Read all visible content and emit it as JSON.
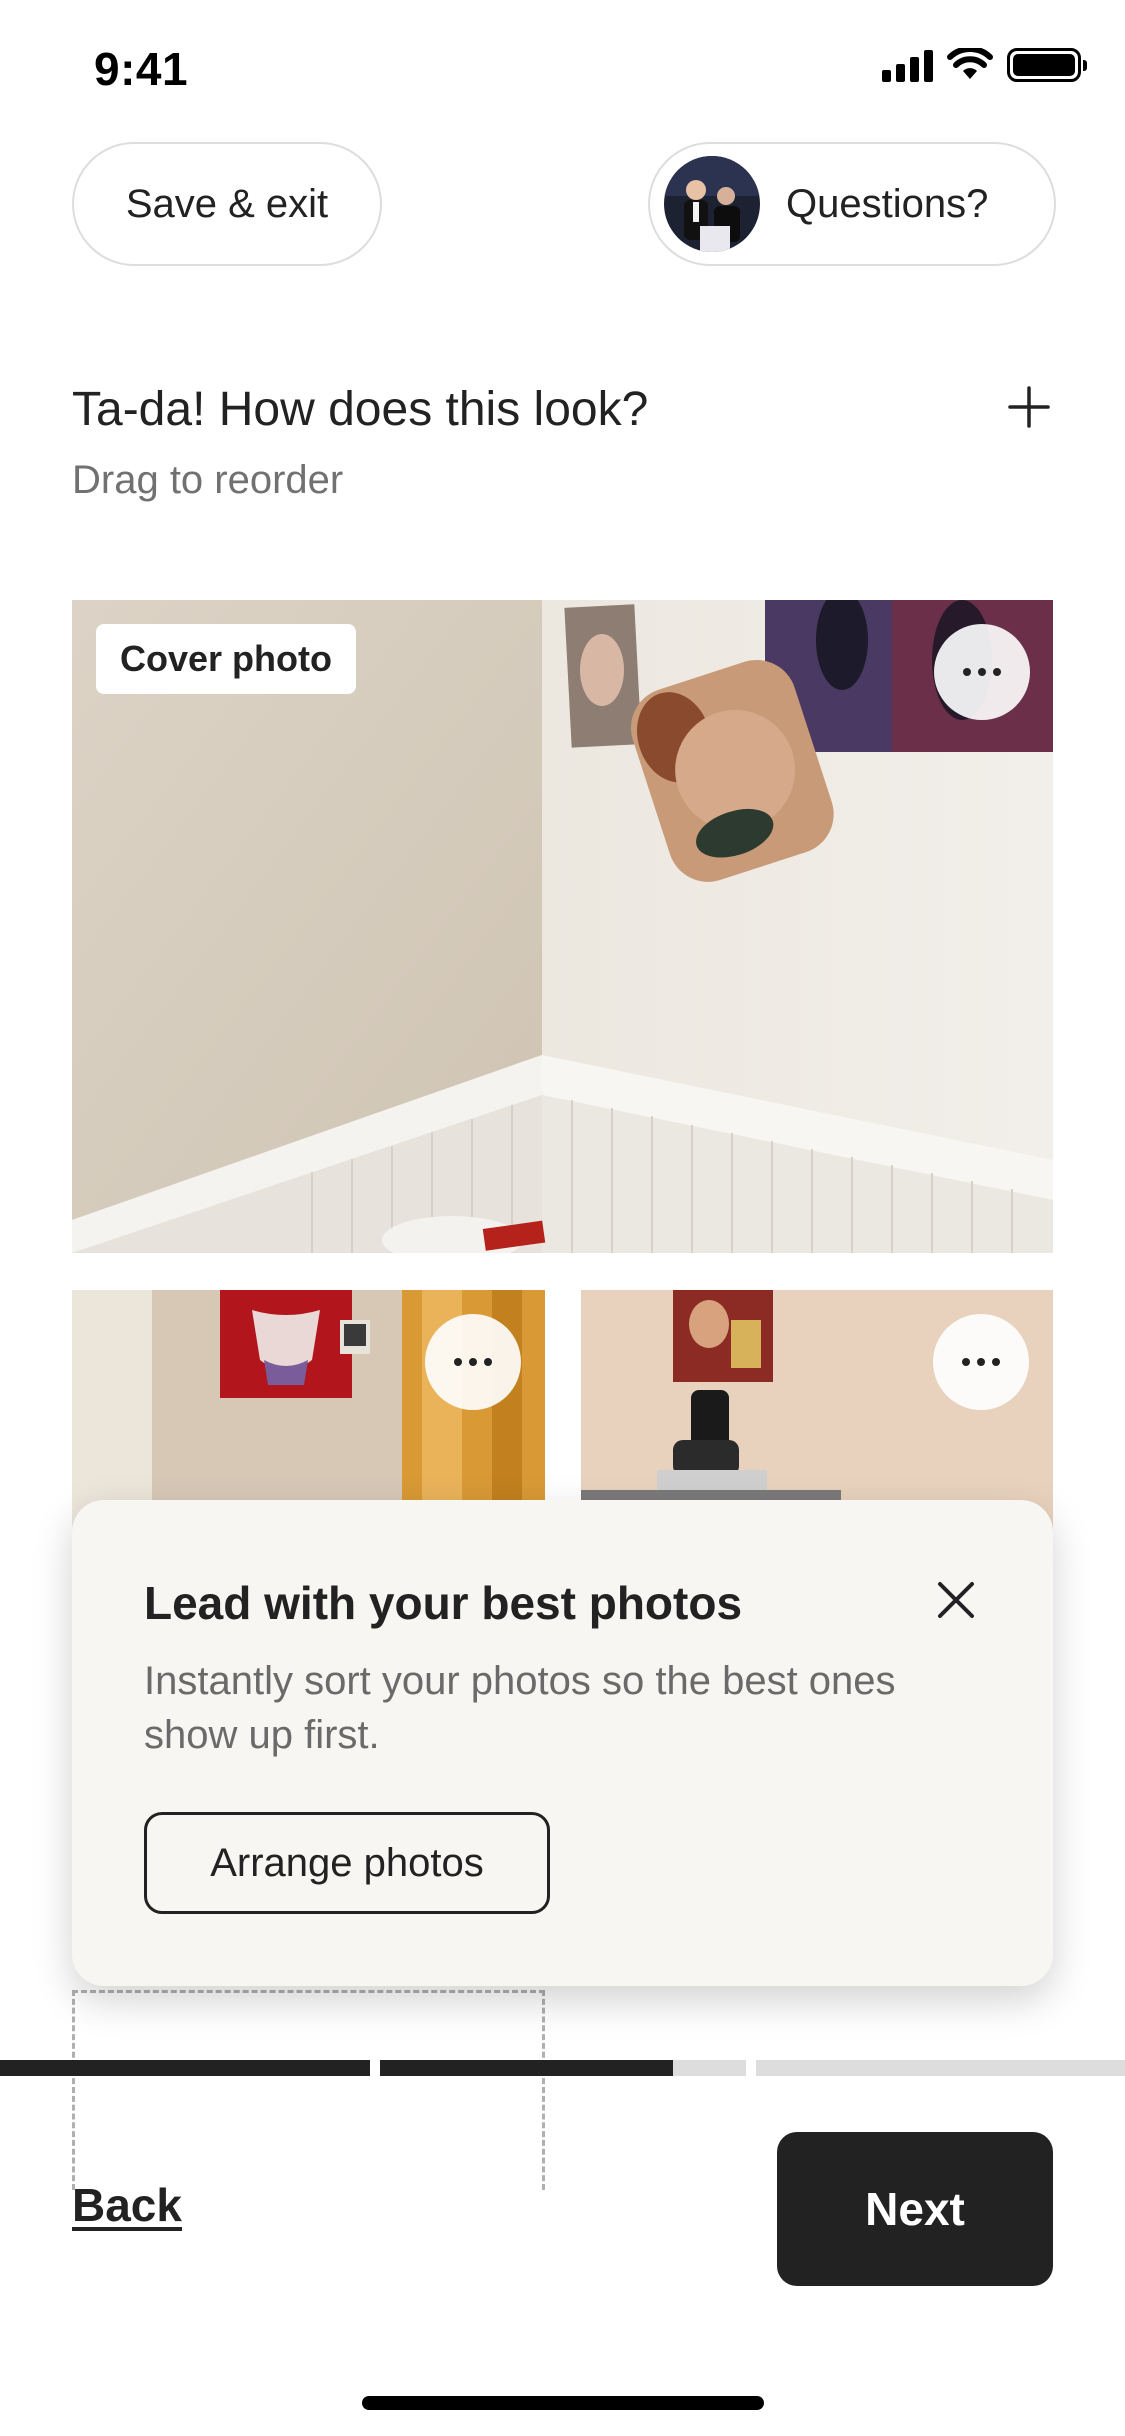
{
  "status_bar": {
    "time": "9:41"
  },
  "header": {
    "save_exit_label": "Save & exit",
    "questions_label": "Questions?"
  },
  "page": {
    "title": "Ta-da! How does this look?",
    "subtitle": "Drag to reorder"
  },
  "photos": {
    "cover_badge": "Cover photo"
  },
  "tip": {
    "title": "Lead with your best photos",
    "body": "Instantly sort your photos so the best ones show up first.",
    "button_label": "Arrange photos"
  },
  "progress": {
    "segments": [
      1,
      1,
      0,
      0
    ],
    "active_segment_fill": 0.8
  },
  "footer": {
    "back_label": "Back",
    "next_label": "Next"
  },
  "icons": [
    "signal-icon",
    "wifi-icon",
    "battery-icon",
    "plus-icon",
    "more-icon",
    "close-icon"
  ],
  "colors": {
    "text": "#222222",
    "muted": "#717171",
    "button": "#222222",
    "card": "#f7f6f2"
  }
}
